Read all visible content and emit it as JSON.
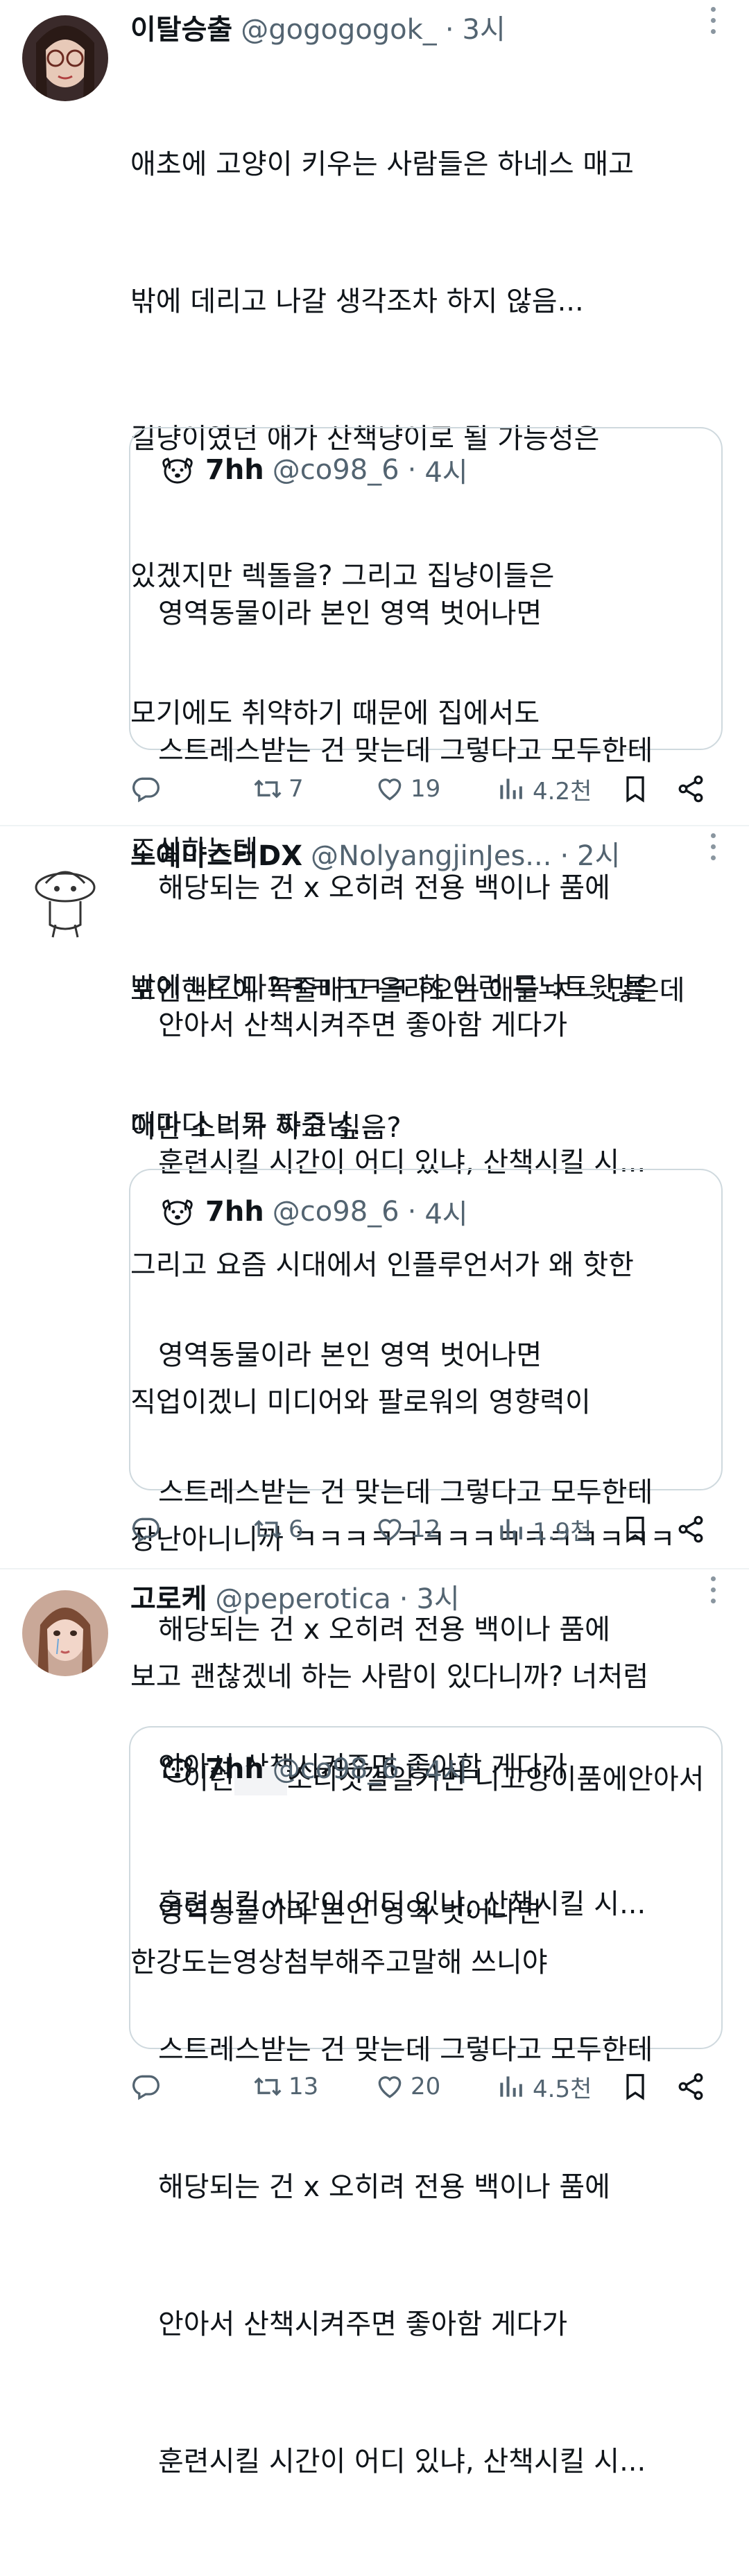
{
  "tweets": [
    {
      "name": "이탈승출",
      "handle": "@gogogogok_",
      "sep": "·",
      "time": "3시",
      "lines": [
        "애초에 고양이 키우는 사람들은 하네스 매고",
        "밖에 데리고 나갈 생각조차 하지 않음...",
        "길냥이였던 애가 산책냥이로 될 가능성은",
        "있겠지만 렉돌을? 그리고 집냥이들은",
        "모기에도 취약하기 때문에 집에서도",
        "조심하는데",
        "밖에 나간다?ㅋㅋㅋㅋㅋ 하 이런 무뇌트윗 볼",
        "때마다 너무 짜증남..."
      ],
      "quote": {
        "name": "7hh",
        "handle": "@co98_6",
        "sep": "·",
        "time": "4시",
        "lines": [
          "영역동물이라 본인 영역 벗어나면",
          "스트레스받는 건 맞는데 그렇다고 모두한테",
          "해당되는 건 x 오히려 전용 백이나 품에",
          "안아서 산책시켜주면 좋아함 게다가",
          "훈련시킬 시간이 어디 있냐, 산책시킬 시..."
        ]
      },
      "retweets": "7",
      "likes": "19",
      "views": "4.2천"
    },
    {
      "name": "노예마스터DX",
      "handle": "@NolyangjinJes...",
      "sep": "·",
      "time": "2시",
      "lines": [
        "포인핸드에 목줄매고 올라오는 애들 ㅈㄴ 많은데",
        "이딴 소리가 하고 싶음?",
        "그리고 요즘 시대에서 인플루언서가 왜 핫한",
        "직업이겠니 미디어와 팔로워의 영향력이",
        "장난아니니까 ㅋㅋㅋㅋㅋㅋㅋㅋㅋㅋㅋㅋㅋㅋㅋ",
        "보고 괜찮겠네 하는 사람이 있다니까? 너처럼"
      ],
      "quote": {
        "name": "7hh",
        "handle": "@co98_6",
        "sep": "·",
        "time": "4시",
        "lines": [
          "영역동물이라 본인 영역 벗어나면",
          "스트레스받는 건 맞는데 그렇다고 모두한테",
          "해당되는 건 x 오히려 전용 백이나 품에",
          "안아서 산책시켜주면 좋아함 게다가",
          "훈련시킬 시간이 어디 있냐, 산책시킬 시..."
        ]
      },
      "retweets": "6",
      "likes": "12",
      "views": "1.9천"
    },
    {
      "name": "고로케",
      "handle": "@peperotica",
      "sep": "·",
      "time": "3시",
      "line1_pre": "이런",
      "line1_post": "소리짓껄일거면 니고양이품에안아서",
      "line2": "한강도는영상첨부해주고말해 쓰니야",
      "quote": {
        "name": "7hh",
        "handle": "@co98_6",
        "sep": "·",
        "time": "4시",
        "lines": [
          "영역동물이라 본인 영역 벗어나면",
          "스트레스받는 건 맞는데 그렇다고 모두한테",
          "해당되는 건 x 오히려 전용 백이나 품에",
          "안아서 산책시켜주면 좋아함 게다가",
          "훈련시킬 시간이 어디 있냐, 산책시킬 시..."
        ]
      },
      "retweets": "13",
      "likes": "20",
      "views": "4.5천"
    }
  ],
  "icons": {
    "reply": "reply-icon",
    "retweet": "retweet-icon",
    "like": "like-icon",
    "views": "views-icon",
    "bookmark": "bookmark-icon",
    "share": "share-icon"
  },
  "colors": {
    "text": "#0f1419",
    "muted": "#536471",
    "border": "#cfd9de",
    "divider": "#eff3f4"
  }
}
